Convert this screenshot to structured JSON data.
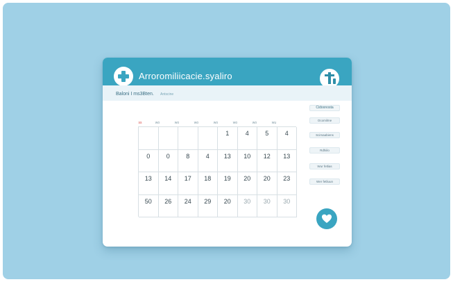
{
  "header": {
    "title": "Arroromiliicacie.syaliro",
    "medical_icon": "medical-cross-icon",
    "calendar_icon": "calendar-icon"
  },
  "subbar": {
    "crumb": "Baloni I ms3Bten.",
    "crumb_sub": "Antscine"
  },
  "calendar": {
    "weekdays": [
      "ss",
      "wo",
      "wo",
      "wo",
      "wo",
      "wo",
      "wo",
      "wu"
    ],
    "rows": [
      [
        "",
        "",
        "",
        "",
        "1",
        "4",
        "5",
        "4"
      ],
      [
        "0",
        "0",
        "8",
        "4",
        "13",
        "10",
        "12",
        "13"
      ],
      [
        "13",
        "14",
        "17",
        "18",
        "19",
        "20",
        "20",
        "23"
      ],
      [
        "50",
        "26",
        "24",
        "29",
        "20",
        "30",
        "30",
        "30"
      ]
    ]
  },
  "sidebar": {
    "items": [
      "Cidoonosta",
      "Ocomilme",
      "Scimaabiens",
      "Rdhiilo",
      "Wur fetlias",
      "Wer fetliuun"
    ]
  },
  "fab": {
    "icon": "heart-icon"
  },
  "colors": {
    "accent": "#3aa5c1",
    "background": "#9fd0e6",
    "sunday": "#d9534f"
  }
}
